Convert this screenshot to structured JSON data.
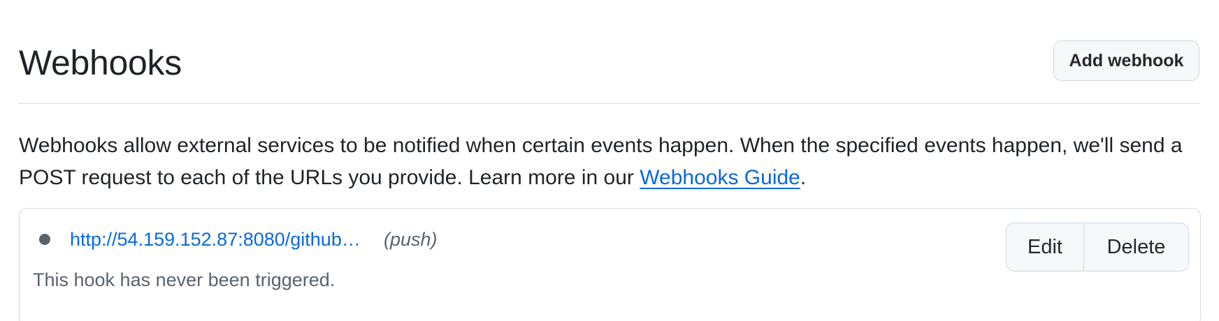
{
  "header": {
    "title": "Webhooks",
    "add_button_label": "Add webhook"
  },
  "description": {
    "text_before_link": "Webhooks allow external services to be notified when certain events happen. When the specified events happen, we'll send a POST request to each of the URLs you provide. Learn more in our ",
    "link_text": "Webhooks Guide",
    "text_after_link": "."
  },
  "hooks": [
    {
      "url": "http://54.159.152.87:8080/github…",
      "events": "(push)",
      "status_text": "This hook has never been triggered.",
      "status_color": "#59636e",
      "edit_label": "Edit",
      "delete_label": "Delete"
    }
  ],
  "colors": {
    "link": "#0969da",
    "border": "#d1d9e0",
    "button_bg": "#f6f8fa"
  }
}
